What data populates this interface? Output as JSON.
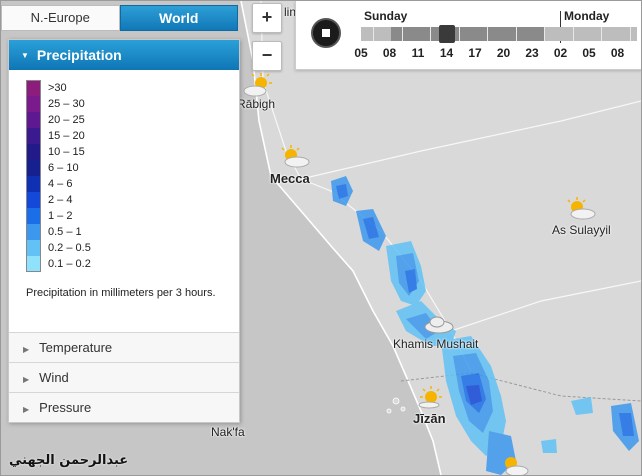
{
  "tabs": [
    {
      "label": "N.-Europe",
      "active": false
    },
    {
      "label": "World",
      "active": true
    }
  ],
  "zoom": {
    "in_label": "+",
    "out_label": "−"
  },
  "panel": {
    "title": "Precipitation",
    "legend": [
      {
        "label": ">30",
        "color": "#8c1d7c"
      },
      {
        "label": "25 – 30",
        "color": "#7a1a8c"
      },
      {
        "label": "20 – 25",
        "color": "#5e1890"
      },
      {
        "label": "15 – 20",
        "color": "#3a1a8e"
      },
      {
        "label": "10 – 15",
        "color": "#231a8a"
      },
      {
        "label": "6 – 10",
        "color": "#16208f"
      },
      {
        "label": "4 – 6",
        "color": "#1030b4"
      },
      {
        "label": "2 – 4",
        "color": "#1448d8"
      },
      {
        "label": "1 – 2",
        "color": "#1a6ee8"
      },
      {
        "label": "0.5 – 1",
        "color": "#3c98ef"
      },
      {
        "label": "0.2 – 0.5",
        "color": "#62c2f6"
      },
      {
        "label": "0.1 – 0.2",
        "color": "#8ee2fb"
      }
    ],
    "note": "Precipitation in millimeters per 3 hours.",
    "sections": [
      "Temperature",
      "Wind",
      "Pressure"
    ]
  },
  "timeline": {
    "days": [
      "Sunday",
      "Monday"
    ],
    "hours": [
      "05",
      "08",
      "11",
      "14",
      "17",
      "20",
      "23",
      "02",
      "05",
      "08"
    ],
    "selected_hour": "14"
  },
  "map": {
    "cities": [
      {
        "name": "Rābigh",
        "big": false
      },
      {
        "name": "Mecca",
        "big": true
      },
      {
        "name": "As Sulayyil",
        "big": false
      },
      {
        "name": "Khamis Mushait",
        "big": false
      },
      {
        "name": "Jīzān",
        "big": true
      },
      {
        "name": "Nak'fa",
        "big": false
      },
      {
        "name": "lina",
        "big": false
      }
    ],
    "weather_icons": [
      "sun-cloud-icon",
      "sun-cloud-icon",
      "sun-cloud-icon",
      "cloud-icon",
      "sun-icon",
      "sun-cloud-icon"
    ]
  },
  "watermark": "عبدالرحمن الجهني"
}
